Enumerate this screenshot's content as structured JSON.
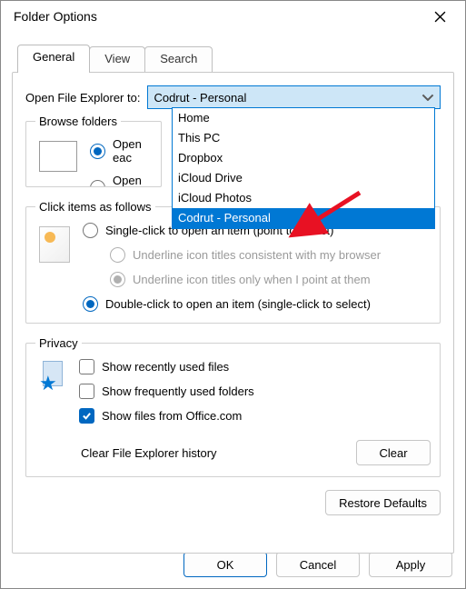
{
  "window": {
    "title": "Folder Options"
  },
  "tabs": {
    "general": "General",
    "view": "View",
    "search": "Search"
  },
  "open_explorer": {
    "label": "Open File Explorer to:",
    "selected": "Codrut - Personal",
    "options": [
      "Home",
      "This PC",
      "Dropbox",
      "iCloud Drive",
      "iCloud Photos",
      "Codrut - Personal"
    ]
  },
  "groups": {
    "browse": {
      "legend": "Browse folders",
      "same_window": "Open eac",
      "own_window": "Open eac"
    },
    "click": {
      "legend": "Click items as follows",
      "single": "Single-click to open an item (point to select)",
      "underline_browser": "Underline icon titles consistent with my browser",
      "underline_point": "Underline icon titles only when I point at them",
      "double": "Double-click to open an item (single-click to select)"
    },
    "privacy": {
      "legend": "Privacy",
      "recent_files": "Show recently used files",
      "frequent_folders": "Show frequently used folders",
      "office": "Show files from Office.com",
      "clear_history_label": "Clear File Explorer history",
      "clear_btn": "Clear"
    }
  },
  "buttons": {
    "restore": "Restore Defaults",
    "ok": "OK",
    "cancel": "Cancel",
    "apply": "Apply"
  }
}
